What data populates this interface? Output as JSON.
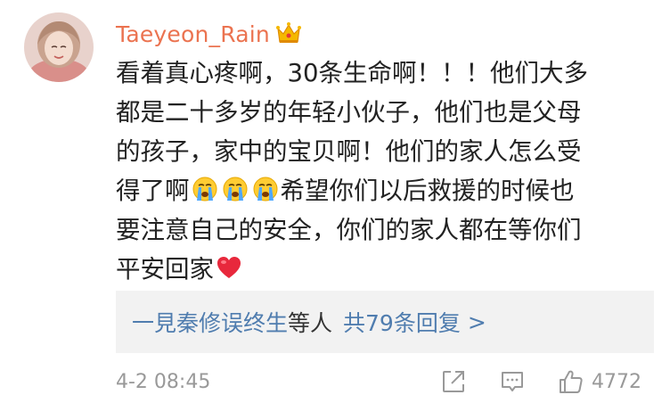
{
  "user": {
    "name": "Taeyeon_Rain",
    "badge_icon": "crown-badge-icon"
  },
  "comment": {
    "line1": "看着真心疼啊，30条生命啊！！！他们大多",
    "line2": "都是二十多岁的年轻小伙子，他们也是父母",
    "line3": "的孩子，家中的宝贝啊！他们的家人怎么受",
    "line4_pre": "得了啊",
    "line4_post": "希望你们以后救援的时候也",
    "line5": "要注意自己的安全，你们的家人都在等你们",
    "line6": "平安回家",
    "emoji_crying": "crying-face-icon",
    "emoji_heart": "red-heart-icon"
  },
  "replies": {
    "names": "一見秦修误终生",
    "suffix": "等人",
    "count_label": "共79条回复",
    "arrow": ">"
  },
  "footer": {
    "timestamp": "4-2 08:45",
    "like_count": "4772"
  },
  "colors": {
    "username": "#eb7350",
    "link": "#507daf",
    "text": "#222222",
    "muted": "#999999",
    "reply_bg": "#f2f2f2"
  }
}
